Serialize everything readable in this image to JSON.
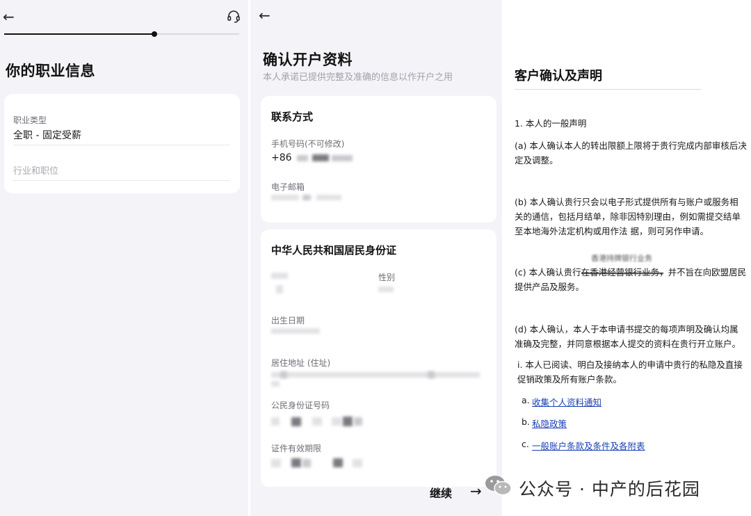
{
  "panel1": {
    "title": "你的职业信息",
    "progress_fraction": 0.64,
    "occupation": {
      "label": "职业类型",
      "value": "全职 - 固定受薪"
    },
    "industry": {
      "placeholder": "行业和职位"
    }
  },
  "panel2": {
    "title": "确认开户资料",
    "subtitle": "本人承诺已提供完整及准确的信息以作开户之用",
    "contact": {
      "title": "联系方式",
      "phone_label": "手机号码(不可修改)",
      "phone_prefix": "+86",
      "email_label": "电子邮箱"
    },
    "id_card": {
      "title": "中华人民共和国居民身份证",
      "gender_label": "性别",
      "dob_label": "出生日期",
      "address_label": "居住地址 (住址)",
      "id_number_label": "公民身份证号码",
      "validity_label": "证件有效期限"
    },
    "continue_label": "继续",
    "continue_arrow": "→"
  },
  "panel3": {
    "title": "客户确认及声明",
    "section1": "1. 本人的一般声明",
    "a": "(a) 本人确认本人的转出限额上限将于贵行完成内部审核后决定及调整。",
    "b": "(b) 本人确认贵行只会以电子形式提供所有与账户或服务相关的通信，包括月结单，除非因特别理由，例如需提交结单至本地海外法定机构或用作法      据，则可另作申请。",
    "overlay": "香港持牌银行业务",
    "c": "(c) 本人确认贵行在香港经营银行业务，并不旨在向欧盟居民提供产品及服务。",
    "d": "(d) 本人确认，本人于本申请书提交的每项声明及确认均属准确及完整，并同意根据本人提交的资料在贵行开立账户。",
    "i": "i. 本人已阅读、明白及接纳本人的申请中贵行的私隐及直接促销政策及所有账户条款。",
    "links": [
      {
        "bullet": "a.",
        "label": "收集个人资料通知"
      },
      {
        "bullet": "b.",
        "label": "私隐政策"
      },
      {
        "bullet": "c.",
        "label": "一般账户条款及条件及各附表"
      }
    ]
  },
  "watermark": {
    "text": "公众号 · 中产的后花园"
  },
  "icons": {
    "back": "back-arrow-icon",
    "support": "headset-icon",
    "wechat": "wechat-icon"
  },
  "colors": {
    "link": "#1a3fb5",
    "progress": "#111111",
    "card": "#ffffff",
    "background": "#f4f4f8"
  }
}
